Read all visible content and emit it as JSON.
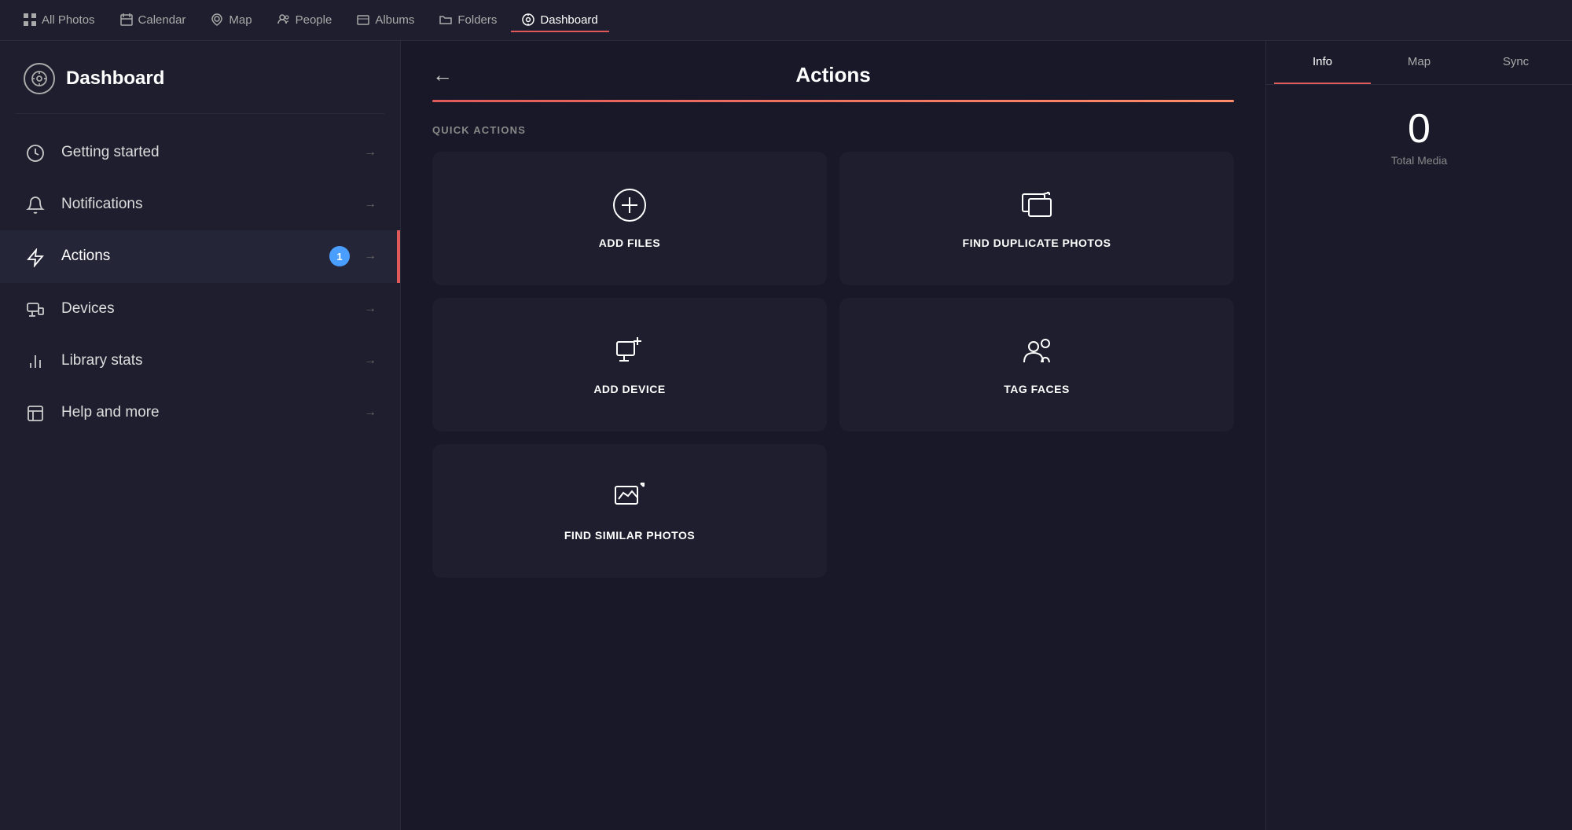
{
  "topNav": {
    "items": [
      {
        "id": "all-photos",
        "label": "All Photos",
        "icon": "grid",
        "active": false
      },
      {
        "id": "calendar",
        "label": "Calendar",
        "icon": "calendar",
        "active": false
      },
      {
        "id": "map",
        "label": "Map",
        "icon": "map",
        "active": false
      },
      {
        "id": "people",
        "label": "People",
        "icon": "people",
        "active": false
      },
      {
        "id": "albums",
        "label": "Albums",
        "icon": "album",
        "active": false
      },
      {
        "id": "folders",
        "label": "Folders",
        "icon": "folder",
        "active": false
      },
      {
        "id": "dashboard",
        "label": "Dashboard",
        "icon": "dashboard",
        "active": true
      }
    ]
  },
  "sidebar": {
    "header": {
      "title": "Dashboard",
      "icon": "⊙"
    },
    "items": [
      {
        "id": "getting-started",
        "label": "Getting started",
        "badge": null,
        "active": false
      },
      {
        "id": "notifications",
        "label": "Notifications",
        "badge": null,
        "active": false
      },
      {
        "id": "actions",
        "label": "Actions",
        "badge": "1",
        "active": true
      },
      {
        "id": "devices",
        "label": "Devices",
        "badge": null,
        "active": false
      },
      {
        "id": "library-stats",
        "label": "Library stats",
        "badge": null,
        "active": false
      },
      {
        "id": "help-and-more",
        "label": "Help and more",
        "badge": null,
        "active": false
      }
    ]
  },
  "actionsPanel": {
    "title": "Actions",
    "backLabel": "←",
    "quickActionsLabel": "QUICK ACTIONS",
    "cards": [
      {
        "id": "add-files",
        "label": "ADD FILES",
        "icon": "add-circle"
      },
      {
        "id": "find-duplicate",
        "label": "FIND DUPLICATE PHOTOS",
        "icon": "duplicate"
      },
      {
        "id": "add-device",
        "label": "ADD DEVICE",
        "icon": "add-device"
      },
      {
        "id": "tag-faces",
        "label": "TAG FACES",
        "icon": "faces"
      },
      {
        "id": "find-similar",
        "label": "FIND SIMILAR PHOTOS",
        "icon": "similar"
      }
    ]
  },
  "rightPanel": {
    "tabs": [
      {
        "id": "info",
        "label": "Info",
        "active": true
      },
      {
        "id": "map",
        "label": "Map",
        "active": false
      },
      {
        "id": "sync",
        "label": "Sync",
        "active": false
      }
    ],
    "totalMedia": {
      "number": "0",
      "label": "Total Media"
    }
  }
}
